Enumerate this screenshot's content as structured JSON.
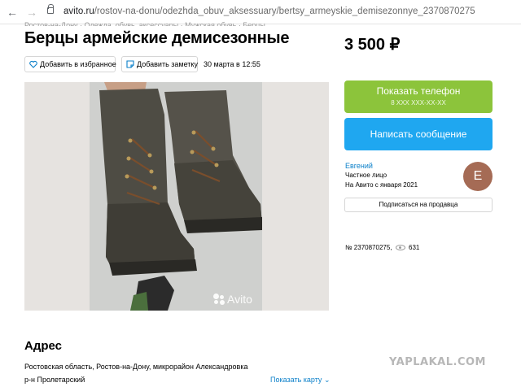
{
  "browser": {
    "url_domain": "avito.ru",
    "url_path": "/rostov-na-donu/odezhda_obuv_aksessuary/bertsy_armeyskie_demisezonnye_2370870275"
  },
  "breadcrumb": "Ростов-на-Дону  ·  Одежда, обувь, аксессуары  ·  Мужская обувь  ·  Берцы",
  "listing": {
    "title": "Берцы армейские демисезонные",
    "price": "3 500 ₽",
    "favorite_label": "Добавить в избранное",
    "note_label": "Добавить заметку",
    "date": "30 марта в 12:55",
    "watermark": "Avito"
  },
  "contact": {
    "phone_button": "Показать телефон",
    "phone_masked": "8 XXX XXX-XX-XX",
    "message_button": "Написать сообщение"
  },
  "seller": {
    "name": "Евгений",
    "type": "Частное лицо",
    "since": "На Авито с января 2021",
    "avatar_letter": "Е",
    "subscribe_label": "Подписаться на продавца"
  },
  "stats": {
    "ad_number": "№ 2370870275,",
    "views": "631"
  },
  "address": {
    "heading": "Адрес",
    "line1": "Ростовская область, Ростов-на-Дону, микрорайон Александровка",
    "line2": "р-н Пролетарский",
    "show_map": "Показать карту"
  },
  "site_watermark": "YAPLAKAL.COM",
  "colors": {
    "phone_button": "#8cc43b",
    "message_button": "#1fa7f0",
    "link": "#0a7fc9",
    "avatar": "#a56b55"
  }
}
